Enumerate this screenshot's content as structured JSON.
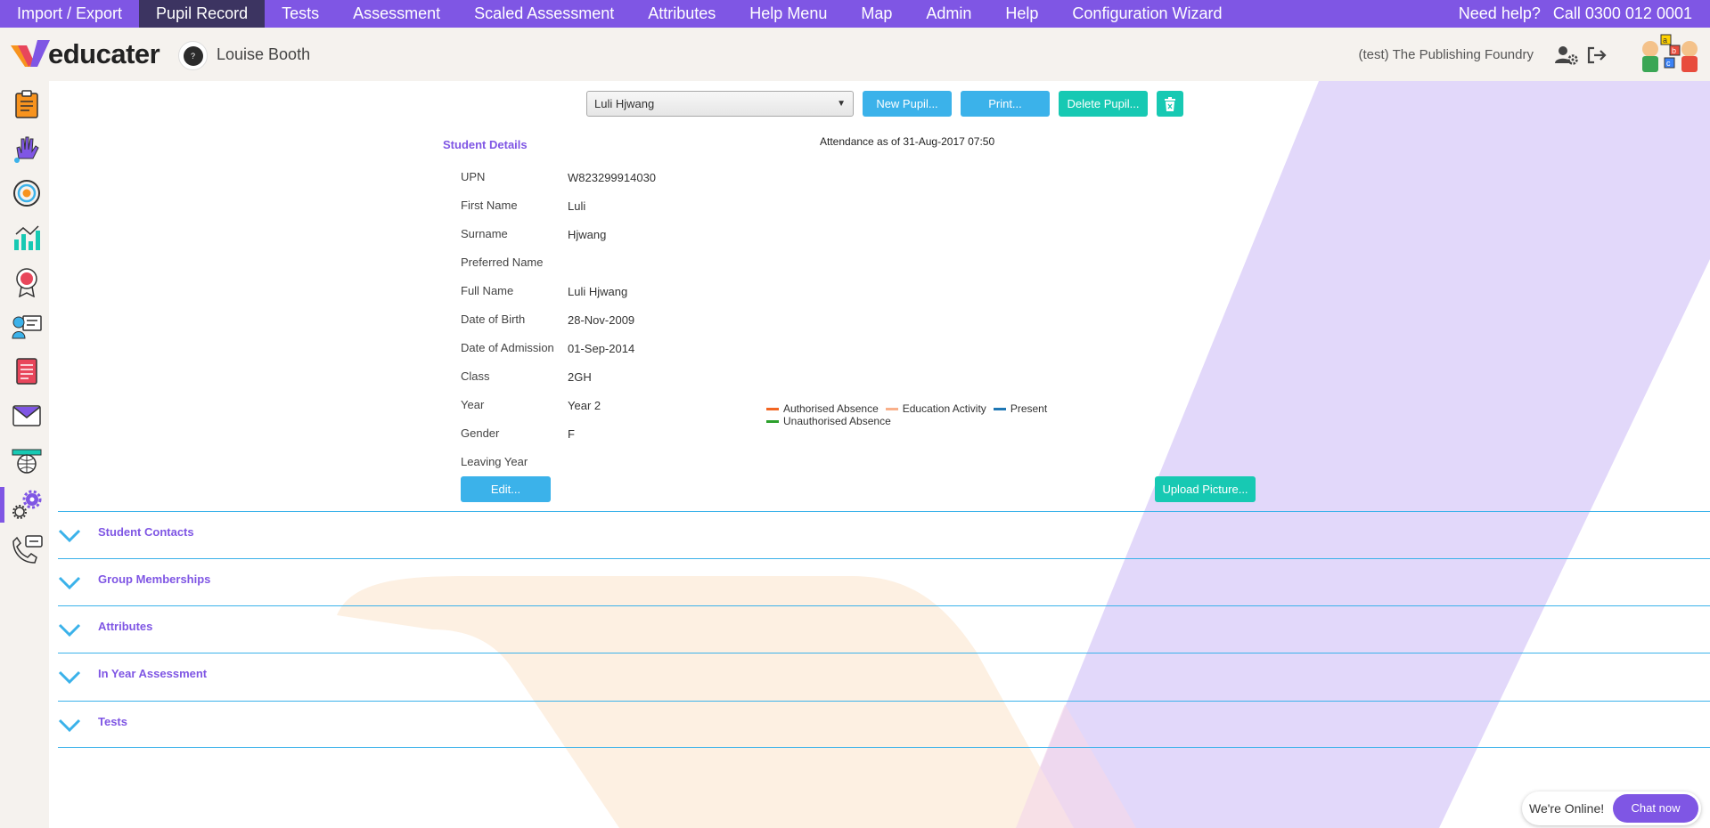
{
  "menu": {
    "items": [
      {
        "label": "Import / Export",
        "active": false
      },
      {
        "label": "Pupil Record",
        "active": true
      },
      {
        "label": "Tests",
        "active": false
      },
      {
        "label": "Assessment",
        "active": false
      },
      {
        "label": "Scaled Assessment",
        "active": false
      },
      {
        "label": "Attributes",
        "active": false
      },
      {
        "label": "Help Menu",
        "active": false
      },
      {
        "label": "Map",
        "active": false
      },
      {
        "label": "Admin",
        "active": false
      },
      {
        "label": "Help",
        "active": false
      },
      {
        "label": "Configuration Wizard",
        "active": false
      }
    ],
    "need_help": "Need help?",
    "call": "Call 0300 012 0001"
  },
  "header": {
    "logo_text": "educater",
    "user_name": "Louise Booth",
    "avatar_glyph": "?",
    "org_name": "(test) The Publishing Foundry"
  },
  "toolbar": {
    "pupil_selected": "Luli Hjwang",
    "new_pupil": "New Pupil...",
    "print": "Print...",
    "delete_pupil": "Delete Pupil..."
  },
  "details": {
    "title": "Student Details",
    "attendance_caption": "Attendance as of 31-Aug-2017 07:50",
    "fields": [
      {
        "label": "UPN",
        "value": "W823299914030"
      },
      {
        "label": "First Name",
        "value": "Luli"
      },
      {
        "label": "Surname",
        "value": "Hjwang"
      },
      {
        "label": "Preferred Name",
        "value": ""
      },
      {
        "label": "Full Name",
        "value": "Luli Hjwang"
      },
      {
        "label": "Date of Birth",
        "value": "28-Nov-2009"
      },
      {
        "label": "Date of Admission",
        "value": "01-Sep-2014"
      },
      {
        "label": "Class",
        "value": "2GH"
      },
      {
        "label": "Year",
        "value": "Year 2"
      },
      {
        "label": "Gender",
        "value": "F"
      },
      {
        "label": "Leaving Year",
        "value": ""
      }
    ],
    "edit_button": "Edit...",
    "upload_button": "Upload Picture..."
  },
  "legend": [
    {
      "label": "Authorised Absence",
      "color": "#f26522"
    },
    {
      "label": "Education Activity",
      "color": "#f9b08a"
    },
    {
      "label": "Present",
      "color": "#1f77b4"
    },
    {
      "label": "Unauthorised Absence",
      "color": "#2ca02c"
    }
  ],
  "accordion": [
    {
      "label": "Student Contacts"
    },
    {
      "label": "Group Memberships"
    },
    {
      "label": "Attributes"
    },
    {
      "label": "In Year Assessment"
    },
    {
      "label": "Tests"
    }
  ],
  "sidebar_icons": [
    "clipboard-icon",
    "hand-icon",
    "target-icon",
    "chart-icon",
    "award-icon",
    "teacher-icon",
    "document-icon",
    "mail-icon",
    "globe-icon",
    "settings-icon",
    "phone-chat-icon"
  ],
  "chat": {
    "status": "We're Online!",
    "button": "Chat now"
  },
  "colors": {
    "brand_purple": "#7f56e4",
    "active_menu": "#3c3461",
    "blue_button": "#3bb2ea",
    "teal_button": "#17c9b3"
  }
}
